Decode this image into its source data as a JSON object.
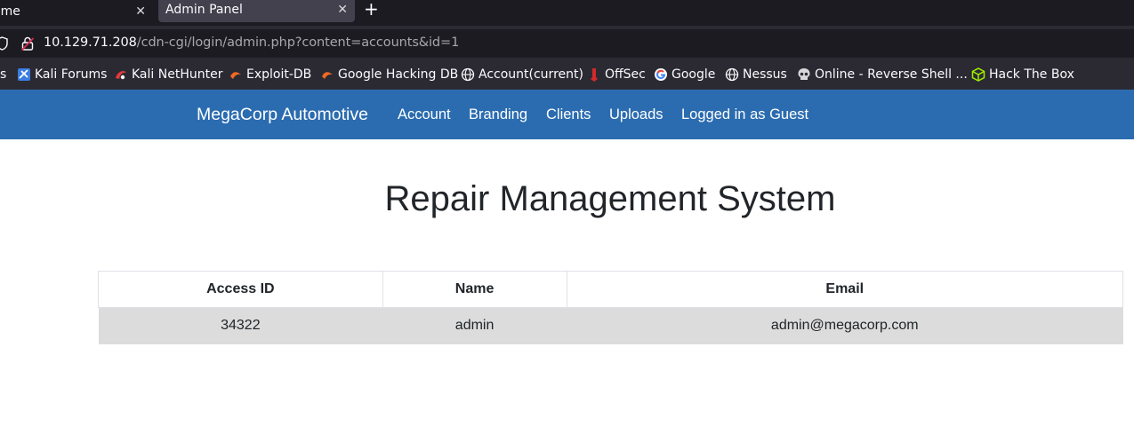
{
  "browser": {
    "tabs": [
      {
        "title": "ome",
        "close": "✕"
      },
      {
        "title": "Admin Panel",
        "close": "✕"
      }
    ],
    "new_tab": "+",
    "url_host": "10.129.71.208",
    "url_path": "/cdn-cgi/login/admin.php?content=accounts&id=1",
    "bookmarks": [
      {
        "label": "s"
      },
      {
        "label": "Kali Forums",
        "icon": "kali-forums-icon"
      },
      {
        "label": "Kali NetHunter",
        "icon": "kali-nethunter-icon"
      },
      {
        "label": "Exploit-DB",
        "icon": "exploit-db-icon"
      },
      {
        "label": "Google Hacking DB",
        "icon": "ghdb-icon"
      },
      {
        "label": "Account(current)",
        "icon": "globe-icon"
      },
      {
        "label": "OffSec",
        "icon": "offsec-icon"
      },
      {
        "label": "Google",
        "icon": "google-icon"
      },
      {
        "label": "Nessus",
        "icon": "globe-icon"
      },
      {
        "label": "Online - Reverse Shell ...",
        "icon": "skull-icon"
      },
      {
        "label": "Hack The Box",
        "icon": "htb-cube-icon"
      }
    ]
  },
  "navbar": {
    "brand": "MegaCorp Automotive",
    "links": [
      "Account",
      "Branding",
      "Clients",
      "Uploads",
      "Logged in as Guest"
    ]
  },
  "main": {
    "title": "Repair Management System",
    "table": {
      "headers": [
        "Access ID",
        "Name",
        "Email"
      ],
      "rows": [
        [
          "34322",
          "admin",
          "admin@megacorp.com"
        ]
      ]
    }
  },
  "colors": {
    "navbar": "#2b6cb0",
    "row_bg": "#dcdcdc",
    "chrome_dark": "#1c1b22"
  }
}
